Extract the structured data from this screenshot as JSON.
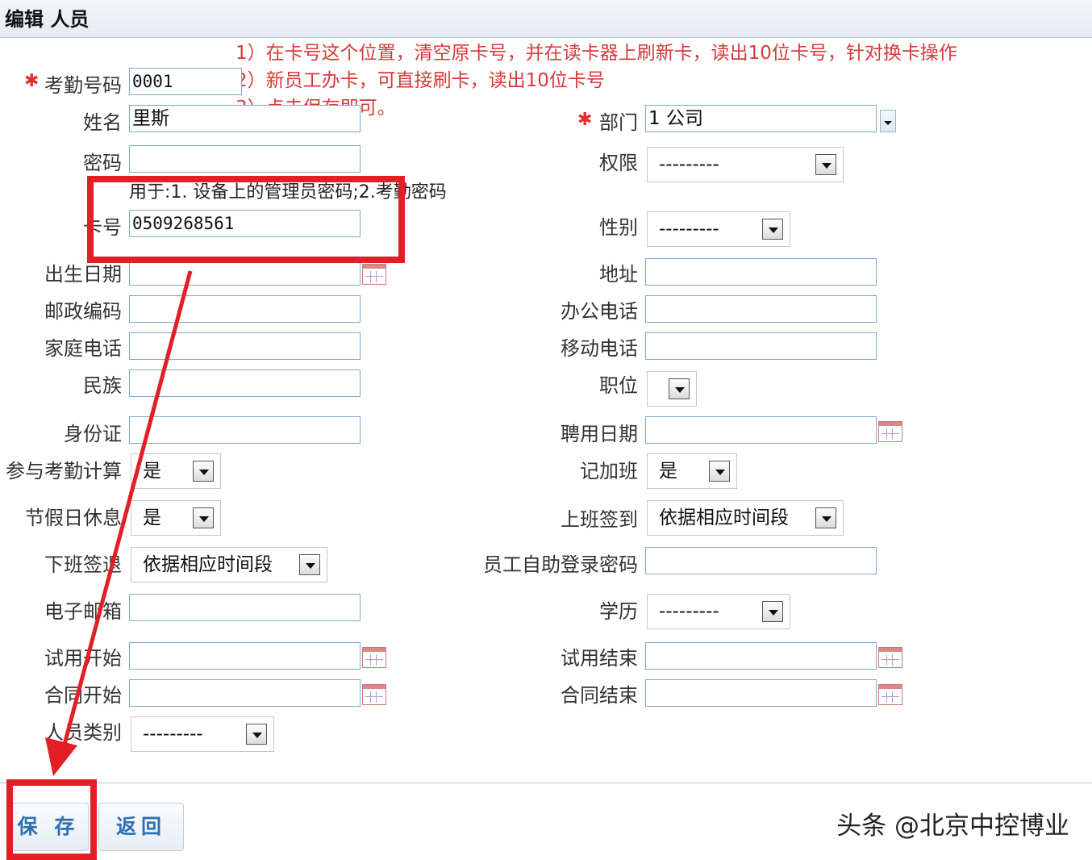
{
  "title": "编辑 人员",
  "notes": [
    "1）在卡号这个位置，清空原卡号，并在读卡器上刷新卡，读出10位卡号，针对换卡操作",
    "2）新员工办卡，可直接刷卡，读出10位卡号",
    "3）点击保存即可。"
  ],
  "left": {
    "attendance_no": {
      "label": "考勤号码",
      "value": "0001"
    },
    "name": {
      "label": "姓名",
      "value": "里斯"
    },
    "password": {
      "label": "密码",
      "value": ""
    },
    "password_hint": "用于:1. 设备上的管理员密码;2.考勤密码",
    "card_no": {
      "label": "卡号",
      "value": "0509268561"
    },
    "birth_date": {
      "label": "出生日期",
      "value": ""
    },
    "postcode": {
      "label": "邮政编码",
      "value": ""
    },
    "home_phone": {
      "label": "家庭电话",
      "value": ""
    },
    "ethnicity": {
      "label": "民族",
      "value": ""
    },
    "id_card": {
      "label": "身份证",
      "value": ""
    },
    "attendance_calc": {
      "label": "参与考勤计算",
      "value": "是"
    },
    "holiday_rest": {
      "label": "节假日休息",
      "value": "是"
    },
    "checkout": {
      "label": "下班签退",
      "value": "依据相应时间段"
    },
    "email": {
      "label": "电子邮箱",
      "value": ""
    },
    "trial_start": {
      "label": "试用开始",
      "value": ""
    },
    "contract_start": {
      "label": "合同开始",
      "value": ""
    },
    "staff_type": {
      "label": "人员类别",
      "value": "---------"
    }
  },
  "right": {
    "department": {
      "label": "部门",
      "value": "1 公司"
    },
    "permission": {
      "label": "权限",
      "value": "---------"
    },
    "gender": {
      "label": "性别",
      "value": "---------"
    },
    "address": {
      "label": "地址",
      "value": ""
    },
    "office_phone": {
      "label": "办公电话",
      "value": ""
    },
    "mobile": {
      "label": "移动电话",
      "value": ""
    },
    "position": {
      "label": "职位",
      "value": ""
    },
    "hire_date": {
      "label": "聘用日期",
      "value": ""
    },
    "overtime": {
      "label": "记加班",
      "value": "是"
    },
    "checkin": {
      "label": "上班签到",
      "value": "依据相应时间段"
    },
    "self_login_pwd": {
      "label": "员工自助登录密码",
      "value": ""
    },
    "education": {
      "label": "学历",
      "value": "---------"
    },
    "trial_end": {
      "label": "试用结束",
      "value": ""
    },
    "contract_end": {
      "label": "合同结束",
      "value": ""
    }
  },
  "buttons": {
    "save": "保 存",
    "back": "返回"
  },
  "watermark": "头条 @北京中控博业",
  "colors": {
    "annotation_red": "#e21f26",
    "note_text": "#d83a3a",
    "button_text": "#2d6fb3"
  }
}
